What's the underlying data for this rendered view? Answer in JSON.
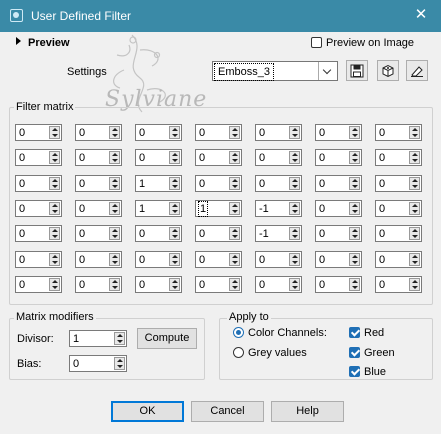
{
  "window": {
    "title": "User Defined Filter",
    "close_glyph": "✕"
  },
  "preview": {
    "toggle_label": "Preview",
    "on_image_label": "Preview on Image",
    "on_image_checked": false
  },
  "settings": {
    "label": "Settings",
    "preset_value": "Emboss_3"
  },
  "toolbar_icons": [
    "save-preset-icon",
    "reset-icon",
    "delete-preset-icon"
  ],
  "watermark": {
    "signature": "Sylviane"
  },
  "filter_matrix": {
    "title": "Filter matrix",
    "rows": [
      [
        "0",
        "0",
        "0",
        "0",
        "0",
        "0",
        "0"
      ],
      [
        "0",
        "0",
        "0",
        "0",
        "0",
        "0",
        "0"
      ],
      [
        "0",
        "0",
        "1",
        "0",
        "0",
        "0",
        "0"
      ],
      [
        "0",
        "0",
        "1",
        "1",
        "-1",
        "0",
        "0"
      ],
      [
        "0",
        "0",
        "0",
        "0",
        "-1",
        "0",
        "0"
      ],
      [
        "0",
        "0",
        "0",
        "0",
        "0",
        "0",
        "0"
      ],
      [
        "0",
        "0",
        "0",
        "0",
        "0",
        "0",
        "0"
      ]
    ]
  },
  "matrix_modifiers": {
    "title": "Matrix modifiers",
    "divisor_label": "Divisor:",
    "divisor_value": "1",
    "bias_label": "Bias:",
    "bias_value": "0",
    "compute_label": "Compute"
  },
  "apply_to": {
    "title": "Apply to",
    "color_channels_label": "Color Channels:",
    "grey_values_label": "Grey values",
    "selected": "color_channels",
    "channels": [
      {
        "label": "Red",
        "checked": true
      },
      {
        "label": "Green",
        "checked": true
      },
      {
        "label": "Blue",
        "checked": true
      }
    ]
  },
  "footer": {
    "ok_label": "OK",
    "cancel_label": "Cancel",
    "help_label": "Help"
  },
  "colors": {
    "titlebar": "#3a8aa7",
    "accent": "#1f6fb5"
  }
}
